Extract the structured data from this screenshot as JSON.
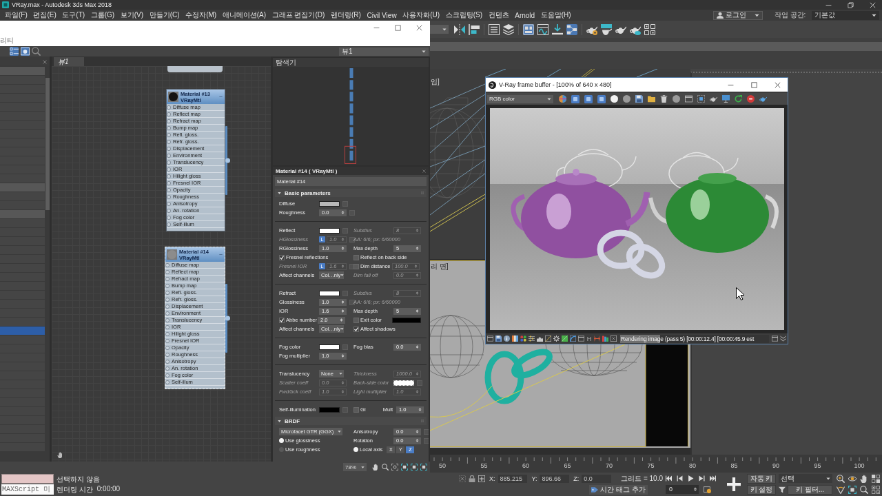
{
  "window": {
    "title": "VRay.max - Autodesk 3ds Max 2018"
  },
  "menu": [
    "파일(F)",
    "편집(E)",
    "도구(T)",
    "그룹(G)",
    "보기(V)",
    "만들기(C)",
    "수정자(M)",
    "애니메이션(A)",
    "그래프 편집기(D)",
    "렌더링(R)",
    "Civil View",
    "사용자화(U)",
    "스크립팅(S)",
    "컨텐츠",
    "Arnold",
    "도움말(H)"
  ],
  "account": {
    "user": "로그인",
    "workspace_label": "작업 공간:",
    "workspace": "기본값"
  },
  "main_toolbar": [
    {
      "on": false
    },
    {
      "on": false
    },
    {
      "on": false
    },
    {
      "on": false
    },
    {
      "on": true
    },
    {
      "on": false
    },
    {
      "on": false
    },
    {
      "on": true
    },
    {
      "on": false
    },
    {
      "on": false
    },
    {
      "on": false
    },
    {
      "on": false
    },
    {
      "on": false
    }
  ],
  "slate": {
    "menu_fragment": "리티",
    "toolbar": [
      {
        "on": true
      },
      {
        "on": true
      },
      {
        "on": false
      }
    ],
    "view_dropdown": "뷰1",
    "browser_rows": [
      {
        "kind": "group",
        "selected": false
      },
      {
        "kind": "item",
        "selected": false
      },
      {
        "kind": "item",
        "selected": false
      },
      {
        "kind": "item",
        "selected": false
      },
      {
        "kind": "item",
        "selected": false
      },
      {
        "kind": "item",
        "selected": false
      },
      {
        "kind": "item",
        "selected": false
      },
      {
        "kind": "item",
        "selected": false
      },
      {
        "kind": "item",
        "selected": false
      },
      {
        "kind": "item",
        "selected": false
      },
      {
        "kind": "item",
        "selected": false
      },
      {
        "kind": "item",
        "selected": false
      },
      {
        "kind": "item",
        "selected": false
      },
      {
        "kind": "group",
        "selected": false
      },
      {
        "kind": "item",
        "selected": false
      },
      {
        "kind": "item",
        "selected": false
      },
      {
        "kind": "group",
        "selected": false
      },
      {
        "kind": "item",
        "selected": false
      },
      {
        "kind": "item",
        "selected": false
      },
      {
        "kind": "item",
        "selected": false
      },
      {
        "kind": "item",
        "selected": false
      },
      {
        "kind": "item",
        "selected": false
      },
      {
        "kind": "item",
        "selected": false
      },
      {
        "kind": "item",
        "selected": false
      },
      {
        "kind": "item",
        "selected": false
      },
      {
        "kind": "item",
        "selected": false
      },
      {
        "kind": "item",
        "selected": false
      },
      {
        "kind": "item",
        "selected": false
      },
      {
        "kind": "item",
        "selected": false
      },
      {
        "kind": "item",
        "selected": true
      },
      {
        "kind": "item",
        "selected": false
      },
      {
        "kind": "item",
        "selected": false
      },
      {
        "kind": "item",
        "selected": false
      },
      {
        "kind": "item",
        "selected": false
      },
      {
        "kind": "item",
        "selected": false
      },
      {
        "kind": "item",
        "selected": false
      },
      {
        "kind": "item",
        "selected": false
      },
      {
        "kind": "item",
        "selected": false
      },
      {
        "kind": "item",
        "selected": false
      },
      {
        "kind": "item",
        "selected": false
      },
      {
        "kind": "item",
        "selected": false
      },
      {
        "kind": "item",
        "selected": false
      },
      {
        "kind": "item",
        "selected": false
      }
    ],
    "tabs": [
      {
        "label": "뷰1",
        "selected": true
      }
    ],
    "nodes": [
      {
        "name": "Material #13",
        "type": "VRayMtl",
        "color": "#141414",
        "selected": false,
        "slots": [
          "Diffuse map",
          "Reflect map",
          "Refract map",
          "Bump map",
          "Refl. gloss.",
          "Refr. gloss.",
          "Displacement",
          "Environment",
          "Translucency",
          "IOR",
          "Hilight gloss",
          "Fresnel IOR",
          "Opacity",
          "Roughness",
          "Anisotropy",
          "An. rotation",
          "Fog color",
          "Self-illum"
        ]
      },
      {
        "name": "Material #14",
        "type": "VRayMtl",
        "color": "#8c8c8c",
        "selected": true,
        "slots": [
          "Diffuse map",
          "Reflect map",
          "Refract map",
          "Bump map",
          "Refl. gloss.",
          "Refr. gloss.",
          "Displacement",
          "Environment",
          "Translucency",
          "IOR",
          "Hilight gloss",
          "Fresnel IOR",
          "Opacity",
          "Roughness",
          "Anisotropy",
          "An. rotation",
          "Fog color",
          "Self-illum"
        ]
      }
    ],
    "navigator": "탐색기",
    "params": {
      "title": "Material #14  ( VRayMtl )",
      "name": "Material #14",
      "rollouts": [
        {
          "title": "Basic parameters",
          "expanded": true,
          "sections": [
            {
              "rows": [
                {
                  "left": [
                    {
                      "kind": "color",
                      "label": "Diffuse",
                      "color": "#b8b8b8",
                      "map": true,
                      "disabled": false
                    }
                  ]
                },
                {
                  "left": [
                    {
                      "kind": "spinner",
                      "label": "Roughness",
                      "value": "0.0",
                      "map": true,
                      "disabled": false
                    }
                  ]
                }
              ]
            },
            {
              "rows": [
                {
                  "left": [
                    {
                      "kind": "color",
                      "label": "Reflect",
                      "color": "#ffffff",
                      "map": true,
                      "disabled": false
                    }
                  ],
                  "right": [
                    {
                      "kind": "spinner",
                      "label": "Subdivs",
                      "value": "8",
                      "disabled": true
                    }
                  ]
                },
                {
                  "left": [
                    {
                      "kind": "spinner",
                      "label": "HGlossiness",
                      "lock": "L",
                      "value": "1.0",
                      "map": true,
                      "disabled": true
                    }
                  ],
                  "right": [
                    {
                      "kind": "info",
                      "label": "AA: 6/6; px: 6/60000",
                      "disabled": true
                    }
                  ]
                },
                {
                  "left": [
                    {
                      "kind": "spinner",
                      "label": "RGlossiness",
                      "value": "1.0",
                      "disabled": false
                    }
                  ],
                  "right": [
                    {
                      "kind": "spinner",
                      "label": "Max depth",
                      "value": "5",
                      "disabled": false
                    }
                  ]
                },
                {
                  "left": [
                    {
                      "kind": "check",
                      "label": "Fresnel reflections",
                      "checked": true
                    }
                  ],
                  "right": [
                    {
                      "kind": "check",
                      "label": "Reflect on back side",
                      "checked": false
                    }
                  ]
                },
                {
                  "left": [
                    {
                      "kind": "spinner",
                      "label": "Fresnel IOR",
                      "lock": "L",
                      "value": "1.6",
                      "map": true,
                      "disabled": true
                    }
                  ],
                  "right": [
                    {
                      "kind": "check_spinner",
                      "label": "Dim distance",
                      "checked": false,
                      "value": "100.0",
                      "disabled": true
                    }
                  ]
                },
                {
                  "left": [
                    {
                      "kind": "dropdown",
                      "label": "Affect channels",
                      "value": "Col…nly",
                      "disabled": false
                    }
                  ],
                  "right": [
                    {
                      "kind": "spinner",
                      "label": "Dim fall off",
                      "value": "0.0",
                      "disabled": true
                    }
                  ]
                }
              ]
            },
            {
              "rows": [
                {
                  "left": [
                    {
                      "kind": "color",
                      "label": "Refract",
                      "color": "#ffffff",
                      "map": true,
                      "disabled": false
                    }
                  ],
                  "right": [
                    {
                      "kind": "spinner",
                      "label": "Subdivs",
                      "value": "8",
                      "disabled": true
                    }
                  ]
                },
                {
                  "left": [
                    {
                      "kind": "spinner",
                      "label": "Glossiness",
                      "value": "1.0",
                      "map": true,
                      "disabled": false
                    }
                  ],
                  "right": [
                    {
                      "kind": "info",
                      "label": "AA: 6/6; px: 6/60000",
                      "disabled": true
                    }
                  ]
                },
                {
                  "left": [
                    {
                      "kind": "spinner",
                      "label": "IOR",
                      "value": "1.6",
                      "disabled": false
                    }
                  ],
                  "right": [
                    {
                      "kind": "spinner",
                      "label": "Max depth",
                      "value": "5",
                      "disabled": false
                    }
                  ]
                },
                {
                  "left": [
                    {
                      "kind": "check_spinner",
                      "label": "Abbe number",
                      "checked": true,
                      "value": "2.0",
                      "disabled": false
                    }
                  ],
                  "right": [
                    {
                      "kind": "check_color",
                      "label": "Exit color",
                      "checked": false,
                      "color": "#000000"
                    }
                  ]
                },
                {
                  "left": [
                    {
                      "kind": "dropdown",
                      "label": "Affect channels",
                      "value": "Col…nly",
                      "disabled": false
                    }
                  ],
                  "right": [
                    {
                      "kind": "check",
                      "label": "Affect shadows",
                      "checked": true
                    }
                  ]
                }
              ]
            },
            {
              "rows": [
                {
                  "left": [
                    {
                      "kind": "color",
                      "label": "Fog color",
                      "color": "#ffffff",
                      "map": true,
                      "disabled": false
                    }
                  ],
                  "right": [
                    {
                      "kind": "spinner",
                      "label": "Fog bias",
                      "value": "0.0",
                      "disabled": false
                    }
                  ]
                },
                {
                  "left": [
                    {
                      "kind": "spinner",
                      "label": "Fog multiplier",
                      "value": "1.0",
                      "disabled": false
                    }
                  ]
                }
              ]
            },
            {
              "rows": [
                {
                  "left": [
                    {
                      "kind": "dropdown",
                      "label": "Translucency",
                      "value": "None",
                      "disabled": false
                    }
                  ],
                  "right": [
                    {
                      "kind": "spinner",
                      "label": "Thickness",
                      "value": "1000.0",
                      "disabled": true
                    }
                  ]
                },
                {
                  "left": [
                    {
                      "kind": "spinner",
                      "label": "Scatter coeff",
                      "value": "0.0",
                      "disabled": true
                    }
                  ],
                  "right": [
                    {
                      "kind": "color",
                      "label": "Back-side color",
                      "color": "#ffffff",
                      "map": true,
                      "disabled": true
                    }
                  ]
                },
                {
                  "left": [
                    {
                      "kind": "spinner",
                      "label": "Fwd/bck coeff",
                      "value": "1.0",
                      "disabled": true
                    }
                  ],
                  "right": [
                    {
                      "kind": "spinner",
                      "label": "Light multiplier",
                      "value": "1.0",
                      "disabled": true
                    }
                  ]
                }
              ]
            },
            {
              "rows": [
                {
                  "left": [
                    {
                      "kind": "color",
                      "label": "Self-illumination",
                      "color": "#000000",
                      "map": true,
                      "disabled": false
                    }
                  ],
                  "right": [
                    {
                      "kind": "check",
                      "label": "GI",
                      "checked": false
                    },
                    {
                      "kind": "spinner",
                      "label": "Mult",
                      "value": "1.0",
                      "disabled": false
                    }
                  ]
                }
              ]
            }
          ]
        },
        {
          "title": "BRDF",
          "expanded": true,
          "sections": [
            {
              "rows": [
                {
                  "left": [
                    {
                      "kind": "dropdown",
                      "value": "Microfacet GTR (GGX)",
                      "disabled": false
                    }
                  ],
                  "right": [
                    {
                      "kind": "spinner",
                      "label": "Anisotropy",
                      "value": "0.0",
                      "map": true,
                      "disabled": false
                    }
                  ]
                },
                {
                  "left": [
                    {
                      "kind": "radio",
                      "label": "Use glossiness",
                      "selected": true
                    }
                  ],
                  "right": [
                    {
                      "kind": "spinner",
                      "label": "Rotation",
                      "value": "0.0",
                      "map": true,
                      "disabled": false
                    }
                  ]
                },
                {
                  "left": [
                    {
                      "kind": "radio",
                      "label": "Use roughness",
                      "selected": false
                    }
                  ],
                  "right": [
                    {
                      "kind": "axis",
                      "label": "Local axis",
                      "selected": true,
                      "buttons": [
                        {
                          "label": "X",
                          "selected": false
                        },
                        {
                          "label": "Y",
                          "selected": false
                        },
                        {
                          "label": "Z",
                          "selected": true
                        }
                      ]
                    }
                  ]
                }
              ]
            }
          ]
        }
      ]
    },
    "zoom": "78%"
  },
  "viewports": {
    "top_label": "임]",
    "bottom_label": "리 면]"
  },
  "vfb": {
    "title": "V-Ray frame buffer - [100% of 640 x 480]",
    "channel": "RGB color",
    "channels": [
      {
        "on": true
      },
      {
        "on": true
      },
      {
        "on": true
      }
    ],
    "letter": "H",
    "status": "Rendering image (pass 5) [00:00:12.4] [00:00:45.9 est",
    "progress": {
      "level": 0.27
    }
  },
  "timeline": {
    "ticks": [
      "50",
      "55",
      "60",
      "65",
      "70",
      "75",
      "80",
      "85",
      "90",
      "95",
      "100"
    ]
  },
  "status_bar": {
    "maxscript": "MAXScript 미",
    "selection": "선택하지 않음",
    "render_time_label": "렌더링 시간",
    "render_time": "0:00:00",
    "coords": [
      {
        "axis": "X:",
        "value": "885.215"
      },
      {
        "axis": "Y:",
        "value": "896.66"
      },
      {
        "axis": "Z:",
        "value": "0.0"
      }
    ],
    "grid": "그리드 = 10.0",
    "time_tag": "시간 태그 추가",
    "frame": "0",
    "auto_key": "자동 키",
    "set_key": "키 설정",
    "key_mode": "선택",
    "key_filters": "키 필터..."
  }
}
